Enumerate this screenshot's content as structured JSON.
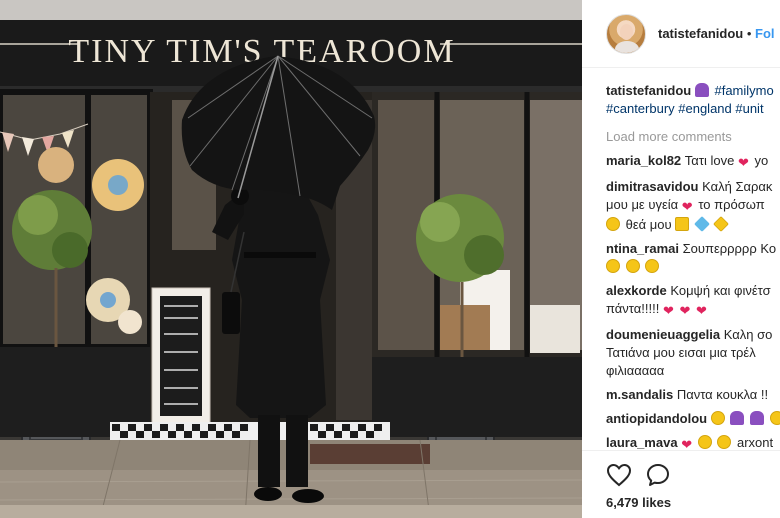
{
  "photo": {
    "shop_sign": "TINY TIM'S TEAROOM"
  },
  "header": {
    "username": "tatistefanidou",
    "separator": "•",
    "follow_label": "Fol"
  },
  "caption": {
    "username": "tatistefanidou",
    "line1": "#familymo",
    "line2": "#canterbury #england #unit"
  },
  "load_more": "Load more comments",
  "comments": [
    {
      "user": "maria_kol82",
      "lines": [
        "Τατι love"
      ],
      "tail": "yo"
    },
    {
      "user": "dimitrasavidou",
      "lines": [
        "Καλή Σαρακ",
        "μου με υγεία",
        "θεά μου"
      ]
    },
    {
      "user": "ntina_ramai",
      "lines": [
        "Σουπερρρρρ Κο"
      ]
    },
    {
      "user": "alexkorde",
      "lines": [
        "Κομψή και φινέτσ",
        "πάντα!!!!!"
      ]
    },
    {
      "user": "doumenieuaggelia",
      "lines": [
        "Καλη σο",
        "Τατιάνα μου εισαι μια τρέλ",
        "φιλιααααα"
      ]
    },
    {
      "user": "m.sandalis",
      "lines": [
        "Παντα κουκλα !!"
      ]
    },
    {
      "user": "antiopidandolou",
      "lines": [
        ""
      ]
    },
    {
      "user": "laura_mava",
      "lines": [
        ""
      ],
      "tail": "arxont"
    }
  ],
  "comment_extras": {
    "dimitra_line2_tail": "το πρόσωπ"
  },
  "likes": "6,479 likes",
  "icons": {
    "like": "heart-outline-icon",
    "comment": "speech-bubble-icon"
  }
}
